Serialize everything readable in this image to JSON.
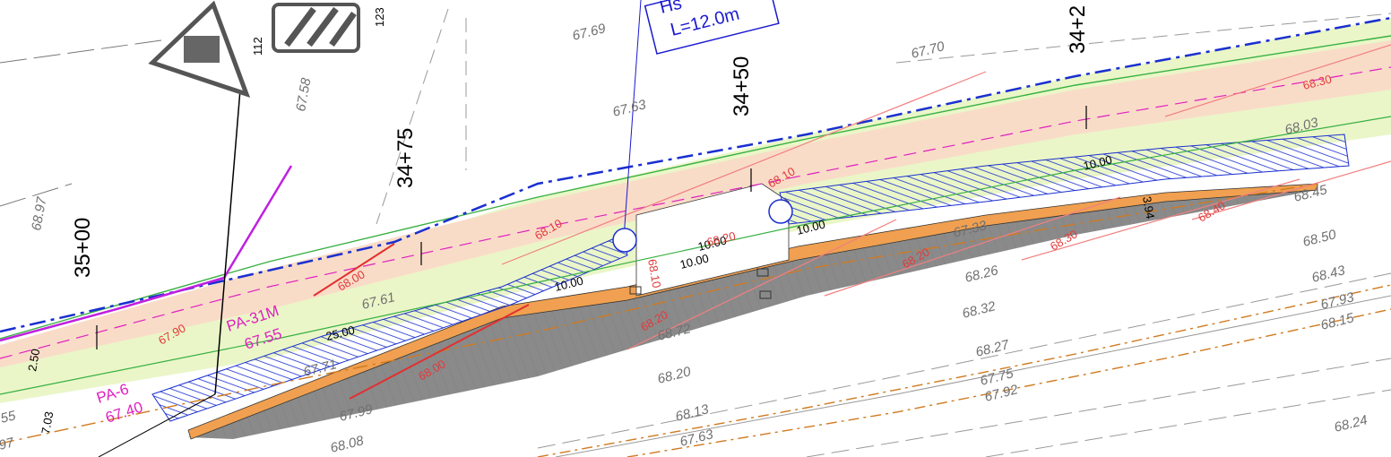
{
  "drawing": {
    "stations": [
      "35+00",
      "34+75",
      "34+50",
      "34+2"
    ],
    "elevations": [
      "67.69",
      "67.70",
      "67.58",
      "67.63",
      "68.97",
      "67.61",
      "67.71",
      "67.99",
      "68.08",
      "68.20",
      "68.13",
      "67.63",
      "68.72",
      "68.32",
      "68.26",
      "67.33",
      "68.27",
      "67.75",
      "67.92",
      "68.50",
      "68.45",
      "68.43",
      "67.93",
      "68.15",
      "68.24",
      "68.03",
      "55",
      "97"
    ],
    "labels": {
      "pa31m": "PA-31M",
      "pa31m_elev": "67.55",
      "pa6": "PA-6",
      "pa6_elev": "67.40",
      "callout_line1": "Hs",
      "callout_line2": "L=12.0m",
      "sign_112": "112",
      "sign_123": "123"
    },
    "dimensions": [
      "2.50",
      "7.03",
      "10.00",
      "10.00",
      "10.00",
      "10.00",
      "3.94",
      "10.00",
      "25.00"
    ],
    "contours": [
      "68.00",
      "68.00",
      "67.90",
      "68.10",
      "68.20",
      "68.10",
      "68.20",
      "68.20",
      "68.30",
      "68.40",
      "68.30",
      "68.10"
    ],
    "colors": {
      "pavement": "#f9dcc8",
      "grass": "#eaf6c8",
      "asphalt": "#8a8a8a",
      "curb": "#f0a050",
      "hatch": "#1a2fd0",
      "dashed_blue": "#1a2fd0",
      "magenta": "#e020c0",
      "red": "#e23030"
    }
  }
}
